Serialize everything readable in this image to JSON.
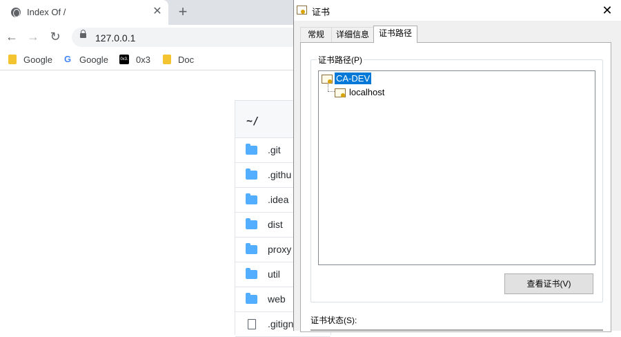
{
  "browser": {
    "tab": {
      "title": "Index Of /",
      "close": "✕"
    },
    "newtab": "+",
    "nav": {
      "back": "←",
      "forward": "→",
      "reload": "↻"
    },
    "address": "127.0.0.1",
    "bookmarks": [
      {
        "label": "Google",
        "icon": "folder-icon"
      },
      {
        "label": "Google",
        "icon": "google-icon",
        "glyph": "G"
      },
      {
        "label": "0x3",
        "icon": "0x3-icon",
        "glyph": "0x3."
      },
      {
        "label": "Doc",
        "icon": "folder-icon"
      }
    ]
  },
  "listing": {
    "header": "~/",
    "rows": [
      {
        "name": ".git",
        "type": "folder"
      },
      {
        "name": ".githu",
        "type": "folder"
      },
      {
        "name": ".idea",
        "type": "folder"
      },
      {
        "name": "dist",
        "type": "folder"
      },
      {
        "name": "proxy",
        "type": "folder"
      },
      {
        "name": "util",
        "type": "folder"
      },
      {
        "name": "web",
        "type": "folder"
      },
      {
        "name": ".gitign",
        "type": "file"
      }
    ]
  },
  "dialog": {
    "title": "证书",
    "close": "✕",
    "tabs": [
      "常规",
      "详细信息",
      "证书路径"
    ],
    "active_tab": "证书路径",
    "group_label": "证书路径(P)",
    "tree": [
      {
        "label": "CA-DEV",
        "selected": true
      },
      {
        "label": "localhost",
        "selected": false
      }
    ],
    "view_button": "查看证书(V)",
    "status_label": "证书状态(S):"
  },
  "colors": {
    "selection": "#0078d7",
    "folder": "#54aeff",
    "tabstrip": "#dee1e6"
  }
}
